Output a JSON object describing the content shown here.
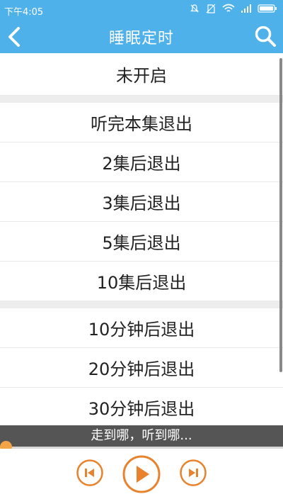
{
  "status_bar": {
    "time": "下午4:05",
    "icons": [
      "mute-icon",
      "no-sim-icon",
      "wifi-icon",
      "signal-icon",
      "battery-icon"
    ]
  },
  "app_bar": {
    "title": "睡眠定时",
    "back_icon": "back-arrow-icon",
    "search_icon": "search-icon"
  },
  "timer_options": {
    "off": "未开启",
    "episode_group": [
      "听完本集退出",
      "2集后退出",
      "3集后退出",
      "5集后退出",
      "10集后退出"
    ],
    "minute_group": [
      "10分钟后退出",
      "20分钟后退出",
      "30分钟后退出"
    ]
  },
  "player": {
    "now_playing": "走到哪，听到哪...",
    "progress": 0,
    "prev_icon": "skip-previous-icon",
    "play_icon": "play-icon",
    "next_icon": "skip-next-icon"
  },
  "colors": {
    "primary": "#4eb1e9",
    "accent": "#e8822c",
    "marquee_bg": "#555555"
  }
}
